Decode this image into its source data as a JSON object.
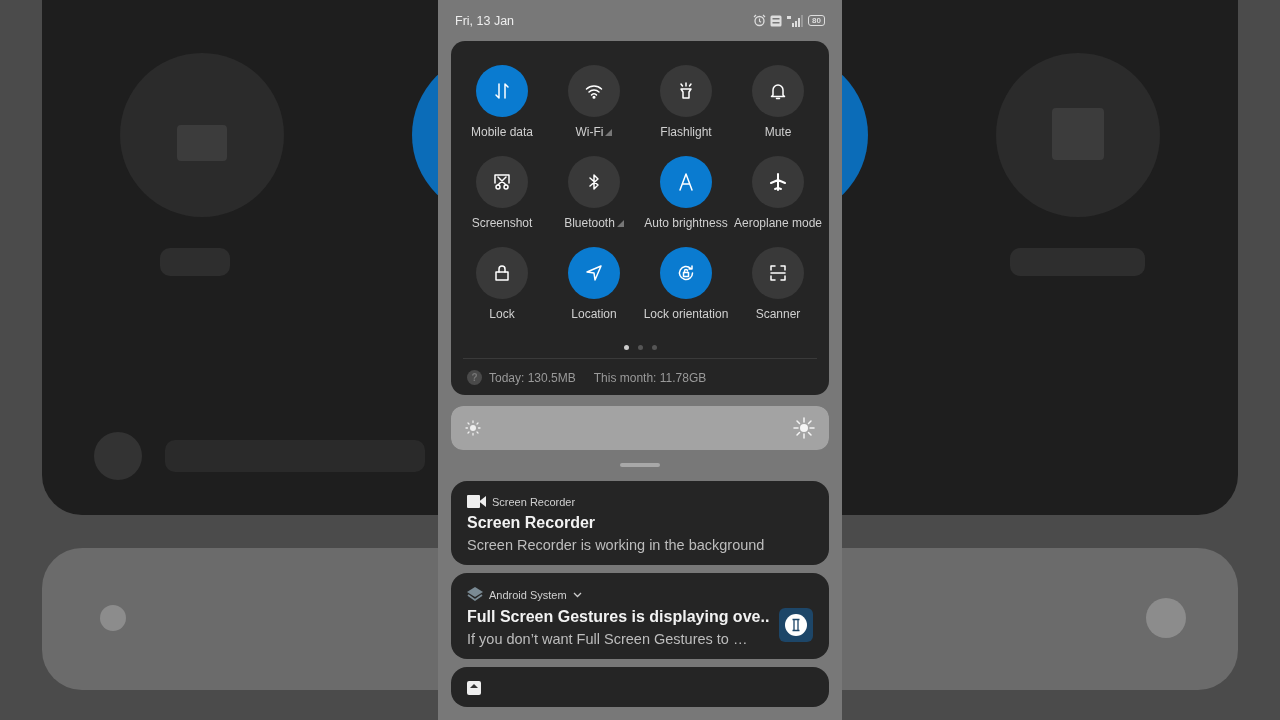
{
  "status_bar": {
    "date": "Fri, 13 Jan",
    "battery": "80"
  },
  "quick_settings": {
    "tiles": [
      {
        "label": "Mobile data",
        "on": true,
        "has_menu": false
      },
      {
        "label": "Wi-Fi",
        "on": false,
        "has_menu": true
      },
      {
        "label": "Flashlight",
        "on": false,
        "has_menu": false
      },
      {
        "label": "Mute",
        "on": false,
        "has_menu": false
      },
      {
        "label": "Screenshot",
        "on": false,
        "has_menu": false
      },
      {
        "label": "Bluetooth",
        "on": false,
        "has_menu": true
      },
      {
        "label": "Auto brightness",
        "on": true,
        "has_menu": false
      },
      {
        "label": "Aeroplane mode",
        "on": false,
        "has_menu": false
      },
      {
        "label": "Lock",
        "on": false,
        "has_menu": false
      },
      {
        "label": "Location",
        "on": true,
        "has_menu": false
      },
      {
        "label": "Lock orientation",
        "on": true,
        "has_menu": false
      },
      {
        "label": "Scanner",
        "on": false,
        "has_menu": false
      }
    ],
    "pages": [
      {
        "selected": true
      },
      {
        "selected": false
      },
      {
        "selected": false
      }
    ],
    "data_usage": {
      "help_glyph": "?",
      "today": "Today: 130.5MB",
      "month": "This month: 11.78GB"
    }
  },
  "brightness": {
    "level": 1
  },
  "notifications": [
    {
      "kind": "recorder",
      "app": "Screen Recorder",
      "title": "Screen Recorder",
      "body": "Screen Recorder is working in the background"
    },
    {
      "kind": "system",
      "app": "Android System",
      "title": "Full Screen Gestures is displaying ove..",
      "body": "If you don’t want Full Screen Gestures to …"
    },
    {
      "kind": "updater"
    }
  ]
}
